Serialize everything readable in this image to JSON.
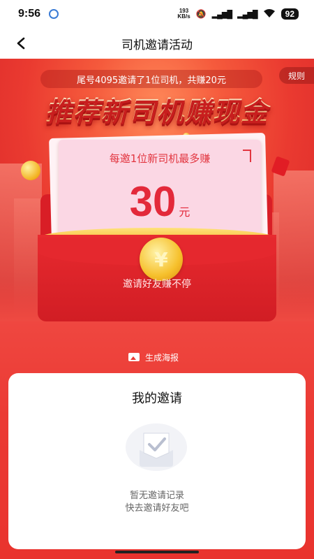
{
  "status_bar": {
    "time": "9:56",
    "net_speed_value": "193",
    "net_speed_unit": "KB/s",
    "battery": "92"
  },
  "nav": {
    "title": "司机邀请活动"
  },
  "hero": {
    "notice": "尾号4095邀请了1位司机，共赚20元",
    "rules": "规则",
    "headline": "推荐新司机赚现金",
    "card_subtitle": "每邀1位新司机最多赚",
    "amount": "30",
    "amount_unit": "元",
    "coin_symbol": "¥",
    "slogan": "邀请好友赚不停"
  },
  "poster_button": {
    "label": "生成海报"
  },
  "invitations": {
    "title": "我的邀请",
    "empty_line1": "暂无邀请记录",
    "empty_line2": "快去邀请好友吧"
  },
  "colors": {
    "brand_red": "#e9332e",
    "amount_red": "#e3293a",
    "gold": "#f6c02c"
  }
}
